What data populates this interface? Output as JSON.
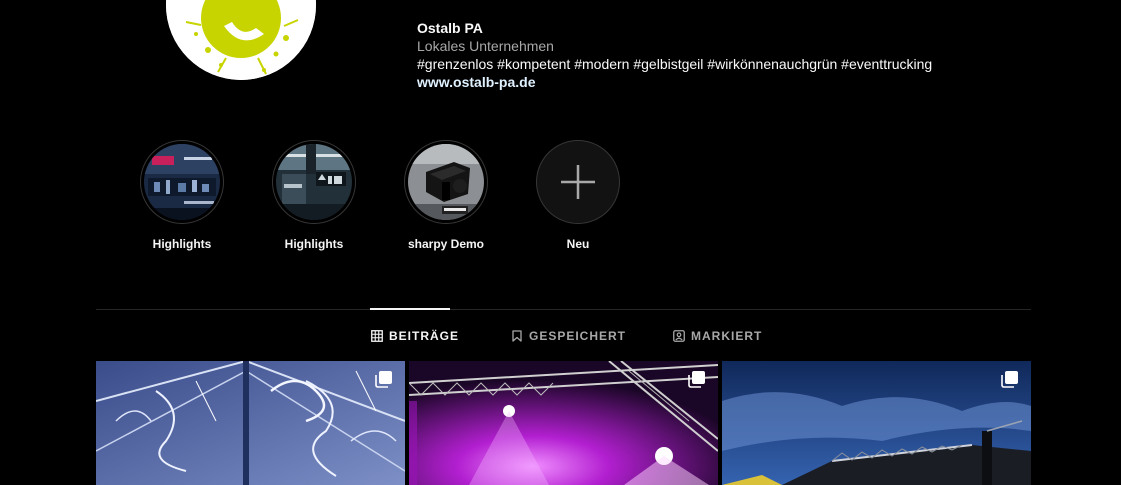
{
  "profile": {
    "name": "Ostalb PA",
    "category": "Lokales Unternehmen",
    "hashtags": "#grenzenlos #kompetent #modern #gelbistgeil #wirkönnenauchgrün #eventtrucking",
    "website": "www.ostalb-pa.de"
  },
  "highlights": [
    {
      "label": "Highlights",
      "icon": "highlight-thumbnail"
    },
    {
      "label": "Highlights",
      "icon": "highlight-thumbnail"
    },
    {
      "label": "sharpy Demo",
      "icon": "highlight-thumbnail"
    },
    {
      "label": "Neu",
      "icon": "plus-icon"
    }
  ],
  "tabs": [
    {
      "label": "BEITRÄGE",
      "icon": "grid-icon",
      "active": true
    },
    {
      "label": "GESPEICHERT",
      "icon": "bookmark-icon",
      "active": false
    },
    {
      "label": "MARKIERT",
      "icon": "tagged-user-icon",
      "active": false
    }
  ],
  "posts": [
    {
      "icon": "multiple-photos-icon"
    },
    {
      "icon": "multiple-photos-icon"
    },
    {
      "icon": "multiple-photos-icon"
    }
  ],
  "colors": {
    "background": "#000000",
    "brand_accent": "#c8d400",
    "link": "#e0f1ff",
    "secondary_text": "#a8a8a8"
  }
}
